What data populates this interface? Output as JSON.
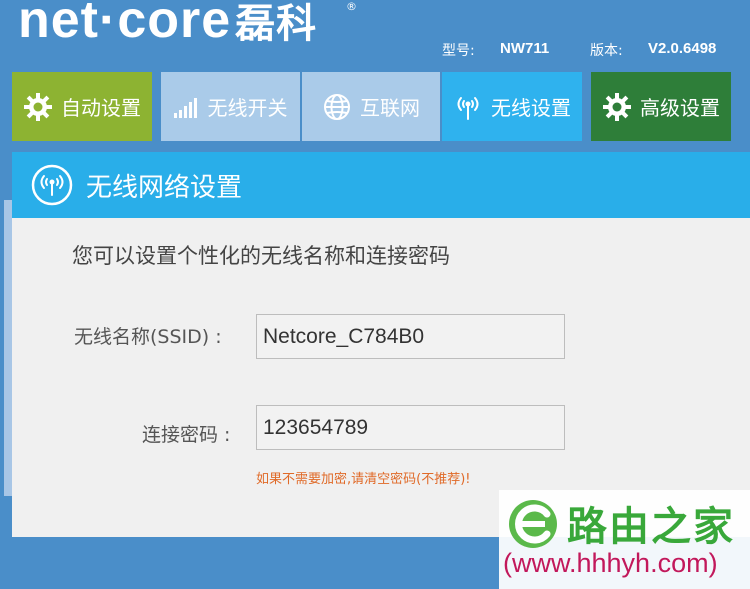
{
  "header": {
    "brand": "net·core",
    "brand_cn": "磊科",
    "registered": "®",
    "model_label": "型号:",
    "model_value": "NW711",
    "version_label": "版本:",
    "version_value": "V2.0.6498"
  },
  "nav": {
    "auto_setup": "自动设置",
    "wireless_switch": "无线开关",
    "internet": "互联网",
    "wireless_settings": "无线设置",
    "advanced_settings": "高级设置"
  },
  "panel": {
    "title": "无线网络设置",
    "intro": "您可以设置个性化的无线名称和连接密码",
    "ssid_label": "无线名称(SSID) :",
    "ssid_value": "Netcore_C784B0",
    "password_label": "连接密码 :",
    "password_value": "123654789",
    "hint": "如果不需要加密,请清空密码(不推荐)!"
  },
  "watermark": {
    "brand": "路由之家",
    "url": "(www.hhhyh.com)"
  },
  "colors": {
    "background": "#4a8ec9",
    "tab_auto": "#8db332",
    "tab_inactive": "#aacbe9",
    "tab_active": "#2fb2ee",
    "tab_advanced": "#2e7e39",
    "panel_header": "#29aee9",
    "hint": "#e06a28"
  },
  "icons": {
    "auto_setup": "gear-icon",
    "wireless_switch": "signal-bars-icon",
    "internet": "globe-icon",
    "wireless_settings": "antenna-icon",
    "advanced_settings": "gear-icon",
    "panel_header": "wifi-antenna-circle-icon"
  }
}
